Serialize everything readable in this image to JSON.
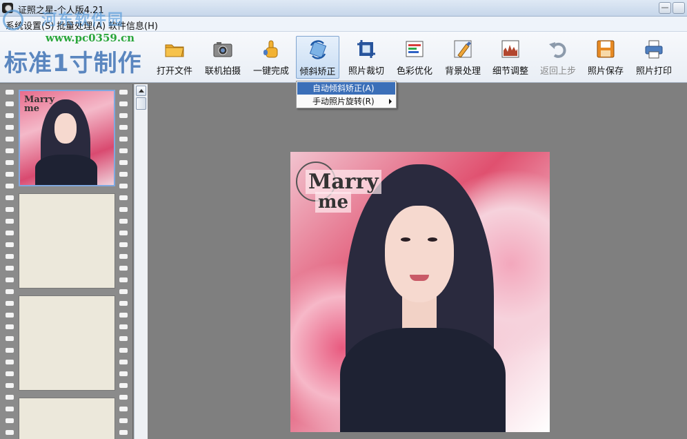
{
  "window": {
    "title": "证照之星-个人版4.21",
    "minimize_label": "—",
    "icon": "camera-app-icon"
  },
  "menubar": {
    "items": [
      {
        "label": "系统设置(S)"
      },
      {
        "label": "批量处理(A)"
      },
      {
        "label": "软件信息(H)"
      }
    ]
  },
  "watermark": {
    "text": "河东软件园",
    "url": "www.pc0359.cn"
  },
  "toolbar": {
    "mode_title": "标准1寸制作",
    "tools": [
      {
        "label": "打开文件",
        "icon": "open-folder-icon"
      },
      {
        "label": "联机拍摄",
        "icon": "camera-icon"
      },
      {
        "label": "一键完成",
        "icon": "hand-pointer-icon"
      },
      {
        "label": "倾斜矫正",
        "icon": "rotate-correct-icon",
        "active": true
      },
      {
        "label": "照片裁切",
        "icon": "crop-icon"
      },
      {
        "label": "色彩优化",
        "icon": "color-levels-icon"
      },
      {
        "label": "背景处理",
        "icon": "background-brush-icon"
      },
      {
        "label": "细节调整",
        "icon": "detail-adjust-icon"
      },
      {
        "label": "返回上步",
        "icon": "undo-icon",
        "disabled": true
      },
      {
        "label": "照片保存",
        "icon": "save-disk-icon"
      },
      {
        "label": "照片打印",
        "icon": "printer-icon"
      }
    ]
  },
  "dropdown": {
    "items": [
      {
        "label": "自动倾斜矫正(A)",
        "selected": true
      },
      {
        "label": "手动照片旋转(R)",
        "submenu": true
      }
    ]
  },
  "photo": {
    "caption_line1": "Marry",
    "caption_line2": "me"
  },
  "colors": {
    "accent": "#5a86bf",
    "selection": "#3b6fb8",
    "canvas_bg": "#7f7f7f"
  }
}
